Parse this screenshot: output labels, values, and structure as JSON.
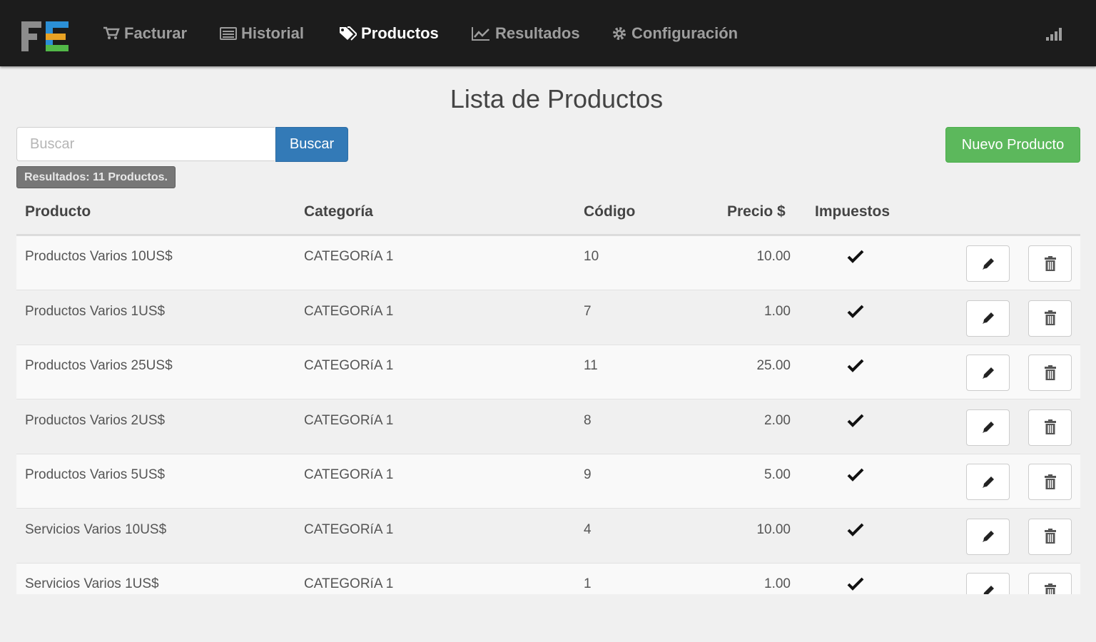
{
  "nav": {
    "items": [
      {
        "label": "Facturar",
        "icon": "cart-icon"
      },
      {
        "label": "Historial",
        "icon": "list-icon"
      },
      {
        "label": "Productos",
        "icon": "tags-icon",
        "active": true
      },
      {
        "label": "Resultados",
        "icon": "chart-icon"
      },
      {
        "label": "Configuración",
        "icon": "gear-icon"
      }
    ],
    "logo_text": "FE",
    "right_icon": "signal-icon"
  },
  "page": {
    "title": "Lista de Productos"
  },
  "search": {
    "placeholder": "Buscar",
    "value": "",
    "button_label": "Buscar"
  },
  "new_button_label": "Nuevo Producto",
  "results_badge": "Resultados: 11 Productos.",
  "table": {
    "headers": {
      "producto": "Producto",
      "categoria": "Categoría",
      "codigo": "Código",
      "precio": "Precio $",
      "impuestos": "Impuestos"
    },
    "rows": [
      {
        "producto": "Productos Varios 10US$",
        "categoria": "CATEGORíA 1",
        "codigo": "10",
        "precio": "10.00",
        "impuestos": true
      },
      {
        "producto": "Productos Varios 1US$",
        "categoria": "CATEGORíA 1",
        "codigo": "7",
        "precio": "1.00",
        "impuestos": true
      },
      {
        "producto": "Productos Varios 25US$",
        "categoria": "CATEGORíA 1",
        "codigo": "11",
        "precio": "25.00",
        "impuestos": true
      },
      {
        "producto": "Productos Varios 2US$",
        "categoria": "CATEGORíA 1",
        "codigo": "8",
        "precio": "2.00",
        "impuestos": true
      },
      {
        "producto": "Productos Varios 5US$",
        "categoria": "CATEGORíA 1",
        "codigo": "9",
        "precio": "5.00",
        "impuestos": true
      },
      {
        "producto": "Servicios Varios 10US$",
        "categoria": "CATEGORíA 1",
        "codigo": "4",
        "precio": "10.00",
        "impuestos": true
      },
      {
        "producto": "Servicios Varios 1US$",
        "categoria": "CATEGORíA 1",
        "codigo": "1",
        "precio": "1.00",
        "impuestos": true
      }
    ],
    "row_icons": {
      "edit": "pencil-icon",
      "delete": "trash-icon",
      "tax": "check-icon"
    }
  },
  "colors": {
    "navbar": "#1c1c1c",
    "primary": "#337ab7",
    "success": "#5cb85c",
    "badge": "#777777",
    "logo_f": "#8c8c8c",
    "logo_e_top": "#2b8fd6",
    "logo_e_mid": "#e8a224",
    "logo_e_bottom": "#52b848"
  }
}
